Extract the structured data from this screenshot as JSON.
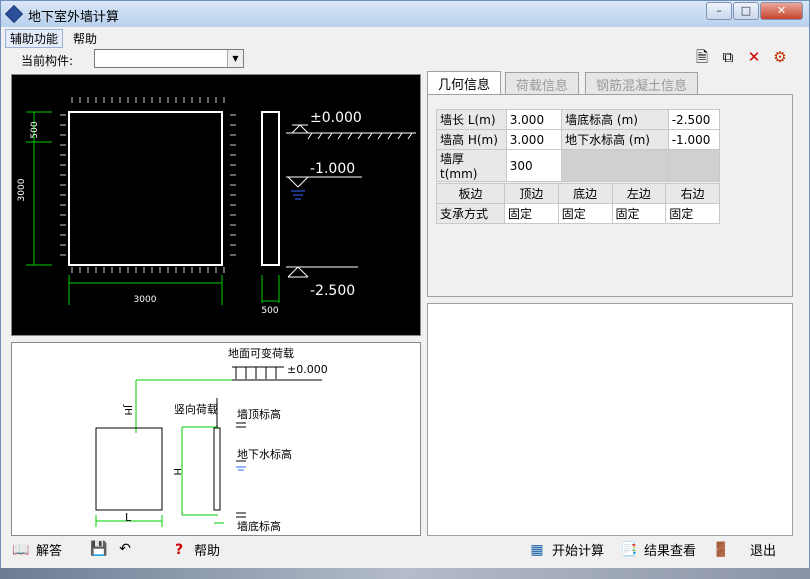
{
  "window": {
    "title": "地下室外墙计算",
    "min": "–",
    "max": "□",
    "close": "✕"
  },
  "menu": {
    "items": [
      "辅助功能",
      "帮助"
    ]
  },
  "current": {
    "label": "当前构件:",
    "value": ""
  },
  "toolbar": {
    "icons": [
      "new-icon",
      "copy-icon",
      "delete-icon",
      "tool-icon"
    ]
  },
  "tabs": [
    "几何信息",
    "荷载信息",
    "钢筋混凝土信息"
  ],
  "geometry": {
    "rows": [
      {
        "l1": "墙长 L(m)",
        "v1": "3.000",
        "l2": "墙底标高 (m)",
        "v2": "-2.500"
      },
      {
        "l1": "墙高 H(m)",
        "v1": "3.000",
        "l2": "地下水标高 (m)",
        "v2": "-1.000"
      },
      {
        "l1": "墙厚 t(mm)",
        "v1": "300",
        "l2": "",
        "v2": ""
      }
    ],
    "support_header": [
      "板边",
      "顶边",
      "底边",
      "左边",
      "右边"
    ],
    "support_row": [
      "支承方式",
      "固定",
      "固定",
      "固定",
      "固定"
    ]
  },
  "drawing": {
    "dim_500_left": "500",
    "dim_3000_left": "3000",
    "dim_3000_bottom": "3000",
    "dim_500_bottom": "500",
    "elev_top": "±0.000",
    "elev_water": "-1.000",
    "elev_bottom": "-2.500"
  },
  "load_diagram": {
    "surface_load": "地面可变荷载",
    "elev_zero": "±0.000",
    "jh": "JH",
    "vertical_load": "竖向荷载",
    "wall_top": "墙顶标高",
    "h": "H",
    "water": "地下水标高",
    "l": "L",
    "wall_bottom": "墙底标高"
  },
  "bottom": {
    "answer": "解答",
    "help": "帮助",
    "start": "开始计算",
    "view": "结果查看",
    "exit": "退出"
  }
}
